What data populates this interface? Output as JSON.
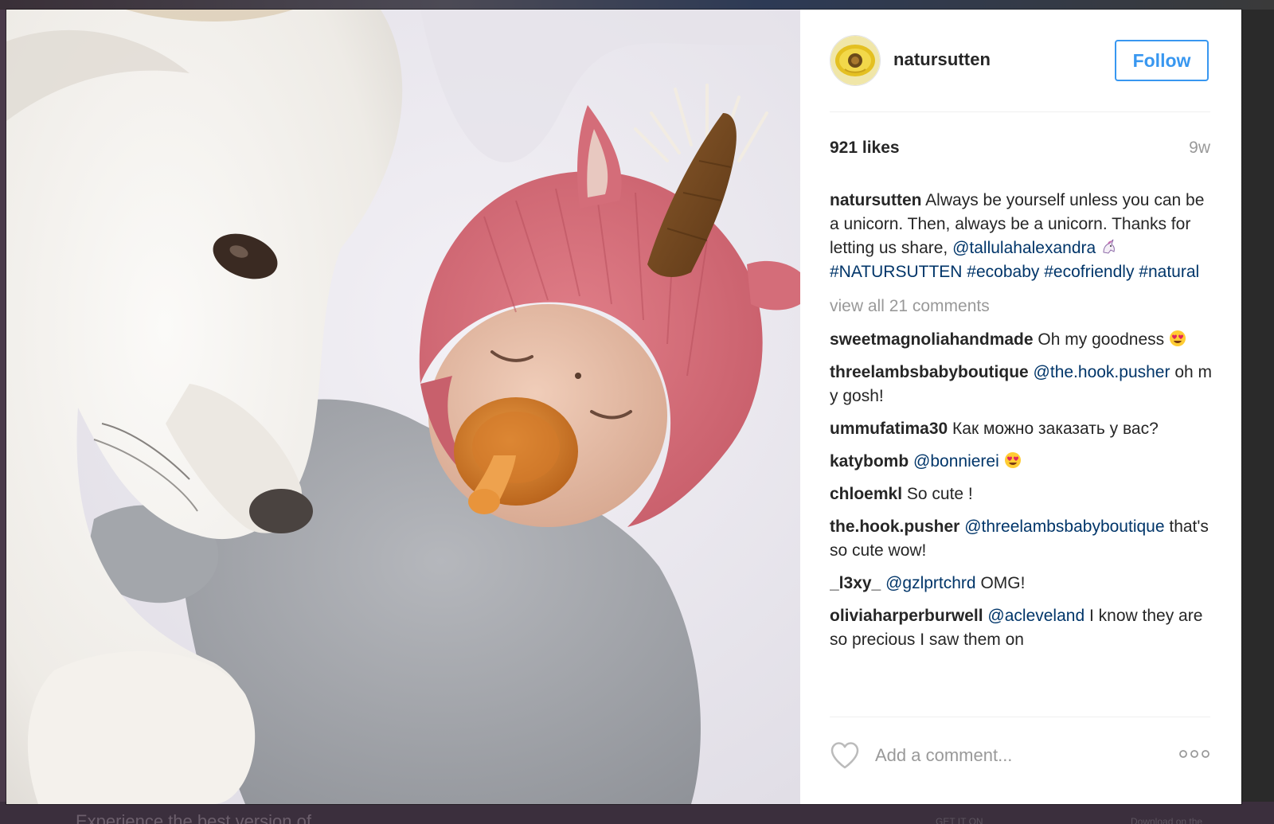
{
  "backdrop": {
    "promo_text": "Experience the best version of",
    "store_badge_1": "GET IT ON",
    "store_badge_2": "Download on the"
  },
  "post": {
    "image_alt": "Baby in a pink knit unicorn hat with a pacifier lying next to a white dog",
    "username": "natursutten",
    "follow_label": "Follow",
    "likes": "921 likes",
    "time_ago": "9w",
    "caption": {
      "user": "natursutten",
      "text": " Always be yourself unless you can be a unicorn. Then, always be a unicorn. Thanks for letting us share, ",
      "mention": "@tallulahalexandra",
      "after_mention": " ",
      "tags": [
        "#NATURSUTTEN",
        "#ecobaby",
        "#ecofriendly",
        "#natural"
      ]
    },
    "view_all_comments": "view all 21 comments",
    "comments": [
      {
        "user": "sweetmagnoliahandmade",
        "mention": "",
        "text": " Oh my goodness ",
        "emoji": "heart-eyes-emoji"
      },
      {
        "user": "threelambsbabyboutique",
        "mention": "@the.hook.pusher",
        "text": " oh my gosh!",
        "emoji": ""
      },
      {
        "user": "ummufatima30",
        "mention": "",
        "text": " Как можно заказать у вас?",
        "emoji": ""
      },
      {
        "user": "katybomb",
        "mention": "@bonnierei",
        "text": " ",
        "emoji": "heart-eyes-emoji"
      },
      {
        "user": "chloemkl",
        "mention": "",
        "text": " So cute !",
        "emoji": ""
      },
      {
        "user": "the.hook.pusher",
        "mention": "@threelambsbabyboutique",
        "text": " that's so cute wow!",
        "emoji": ""
      },
      {
        "user": "_l3xy_",
        "mention": "@gzlprtchrd",
        "text": " OMG!",
        "emoji": ""
      },
      {
        "user": "oliviaharperburwell",
        "mention": "@acleveland",
        "text": " I know they are so precious I saw them on",
        "emoji": ""
      }
    ],
    "comment_placeholder": "Add a comment...",
    "icons": {
      "like": "heart-outline-icon",
      "more": "more-options-icon"
    },
    "colors": {
      "link": "#003569",
      "follow": "#3897f0",
      "muted": "#999999",
      "text": "#262626"
    }
  }
}
